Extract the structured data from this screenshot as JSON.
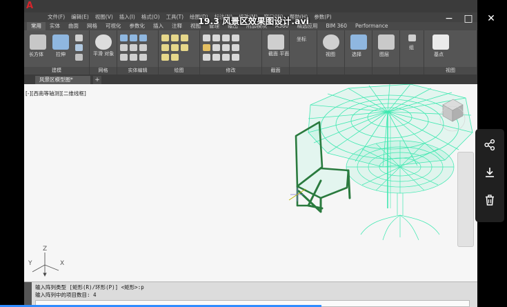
{
  "video": {
    "title": "19.3 风景区效果图设计.avi"
  },
  "window_controls": {
    "minimize": "−",
    "maximize": "□",
    "close": "✕"
  },
  "autocad": {
    "menu": [
      "文件(F)",
      "编辑(E)",
      "视图(V)",
      "插入(I)",
      "格式(O)",
      "工具(T)",
      "绘图(D)",
      "标注(N)",
      "修改(M)",
      "窗口(W)",
      "帮助(H)",
      "参数(P)"
    ],
    "ribbon_tabs": [
      "常用",
      "实体",
      "曲面",
      "网格",
      "可视化",
      "参数化",
      "插入",
      "注释",
      "视图",
      "管理",
      "输出",
      "附加模块",
      "A360",
      "精选应用",
      "BIM 360",
      "Performance"
    ],
    "ribbon_groups": [
      "建模",
      "网格",
      "实体编辑",
      "绘图",
      "修改",
      "截面",
      "坐标",
      "视图",
      "选择",
      "图层",
      "组",
      "视图"
    ],
    "tool_labels": {
      "box": "长方体",
      "extrude": "拉伸",
      "smooth": "平滑\n对象",
      "section_plane": "截面\n平面",
      "view": "视图",
      "select": "选择",
      "layer": "图层",
      "group": "组",
      "base": "基点"
    },
    "document_tab": "风景区模型图*",
    "viewport_label": "[-][西南等轴测][二维线框]",
    "ucs": {
      "x": "X",
      "y": "Y",
      "z": "Z"
    },
    "command_lines": [
      "输入阵列类型 [矩形(R)/环形(P)] <矩形>:p",
      "输入阵列中的项目数目: 4"
    ]
  },
  "colors": {
    "wireframe": "#3ee8b0",
    "chair": "#2a7a3e",
    "progress": "#2f8cff"
  }
}
